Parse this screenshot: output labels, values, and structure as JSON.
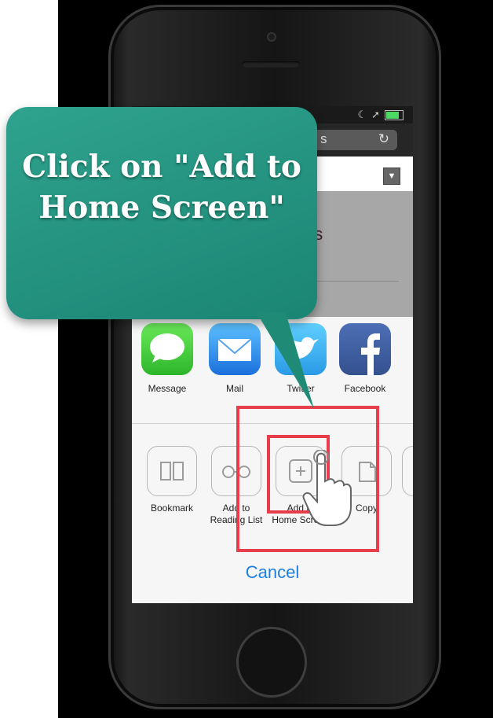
{
  "callout": {
    "text": "Click on \"Add to Home Screen\""
  },
  "status_bar": {
    "icons": [
      "moon-icon",
      "location-arrow-icon",
      "battery-icon"
    ]
  },
  "url_bar": {
    "text": "s",
    "reload_icon": "reload-icon"
  },
  "page_heading_partial": "ns",
  "share_apps": [
    {
      "label": "Message",
      "icon": "message-icon",
      "color": "#3dc33a"
    },
    {
      "label": "Mail",
      "icon": "mail-icon",
      "color": "#2b8cf0"
    },
    {
      "label": "Twitter",
      "icon": "twitter-icon",
      "color": "#35a8ee"
    },
    {
      "label": "Facebook",
      "icon": "facebook-icon",
      "color": "#3b5998"
    }
  ],
  "actions": [
    {
      "label": "Bookmark",
      "label2": "",
      "icon": "book-icon"
    },
    {
      "label": "Add to",
      "label2": "Reading List",
      "icon": "glasses-icon"
    },
    {
      "label": "Add to",
      "label2": "Home Screen",
      "icon": "plus-icon"
    },
    {
      "label": "Copy",
      "label2": "",
      "icon": "copy-icon"
    }
  ],
  "cancel_label": "Cancel",
  "highlight_color": "#e83d4a",
  "callout_color": "#24967f",
  "link_color": "#1f7fe0"
}
